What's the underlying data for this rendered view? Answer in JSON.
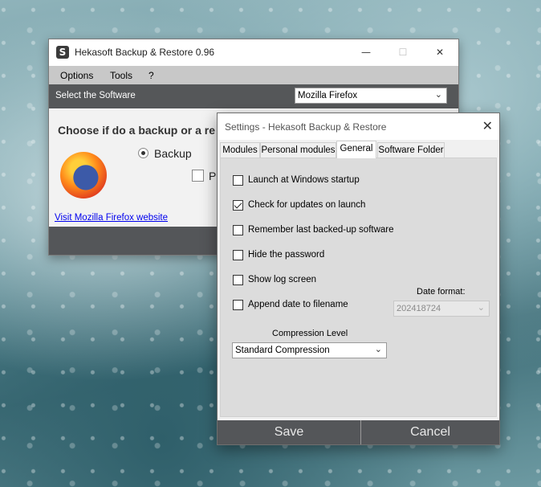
{
  "main_window": {
    "title": "Hekasoft Backup & Restore 0.96",
    "menu": [
      "Options",
      "Tools",
      "?"
    ],
    "select_label": "Select the Software",
    "software_value": "Mozilla Firefox",
    "heading": "Choose if do a backup or a re",
    "option_backup": "Backup",
    "option_partial": "Pa",
    "link": "Visit Mozilla Firefox website"
  },
  "settings": {
    "title": "Settings - Hekasoft Backup & Restore",
    "tabs": [
      "Modules",
      "Personal modules",
      "General",
      "Software Folder"
    ],
    "active_tab": "General",
    "options": [
      {
        "label": "Launch at Windows startup",
        "checked": false
      },
      {
        "label": "Check for updates on launch",
        "checked": true
      },
      {
        "label": "Remember last backed-up software",
        "checked": false
      },
      {
        "label": "Hide the password",
        "checked": false
      },
      {
        "label": "Show log screen",
        "checked": false
      },
      {
        "label": "Append date to filename",
        "checked": false
      }
    ],
    "date_format_label": "Date format:",
    "date_format_value": "202418724",
    "compression_label": "Compression Level",
    "compression_value": "Standard Compression",
    "save_label": "Save",
    "cancel_label": "Cancel"
  },
  "colors": {
    "dark_bar": "#545659",
    "menu_bar": "#c8c8c8",
    "panel": "#dcdcdc",
    "link": "#0000ee"
  },
  "icons": [
    "app-logo-icon",
    "minimize-icon",
    "maximize-icon",
    "close-icon",
    "chevron-down-icon",
    "firefox-logo-icon"
  ]
}
